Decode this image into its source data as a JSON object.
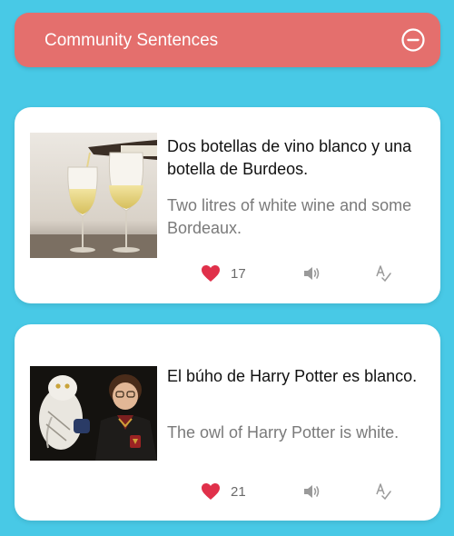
{
  "header": {
    "title": "Community Sentences",
    "collapse_icon": "minus-circle-icon",
    "background": "#e46f6d"
  },
  "page": {
    "background": "#48c9e6"
  },
  "cards": [
    {
      "sentence": "Dos botellas de vino blanco y una botella de Burdeos.",
      "translation": "Two litres of white wine and some Bordeaux.",
      "likes": "17",
      "image": "wine-pouring-photo",
      "icons": [
        "heart-icon",
        "speaker-icon",
        "grammar-icon"
      ]
    },
    {
      "sentence": "El búho de Harry Potter es blanco.",
      "translation": "The owl of Harry Potter is white.",
      "likes": "21",
      "image": "harry-potter-owl-photo",
      "icons": [
        "heart-icon",
        "speaker-icon",
        "grammar-icon"
      ]
    }
  ],
  "colors": {
    "heart": "#e0304a",
    "icon_gray": "#9a9a9a"
  }
}
